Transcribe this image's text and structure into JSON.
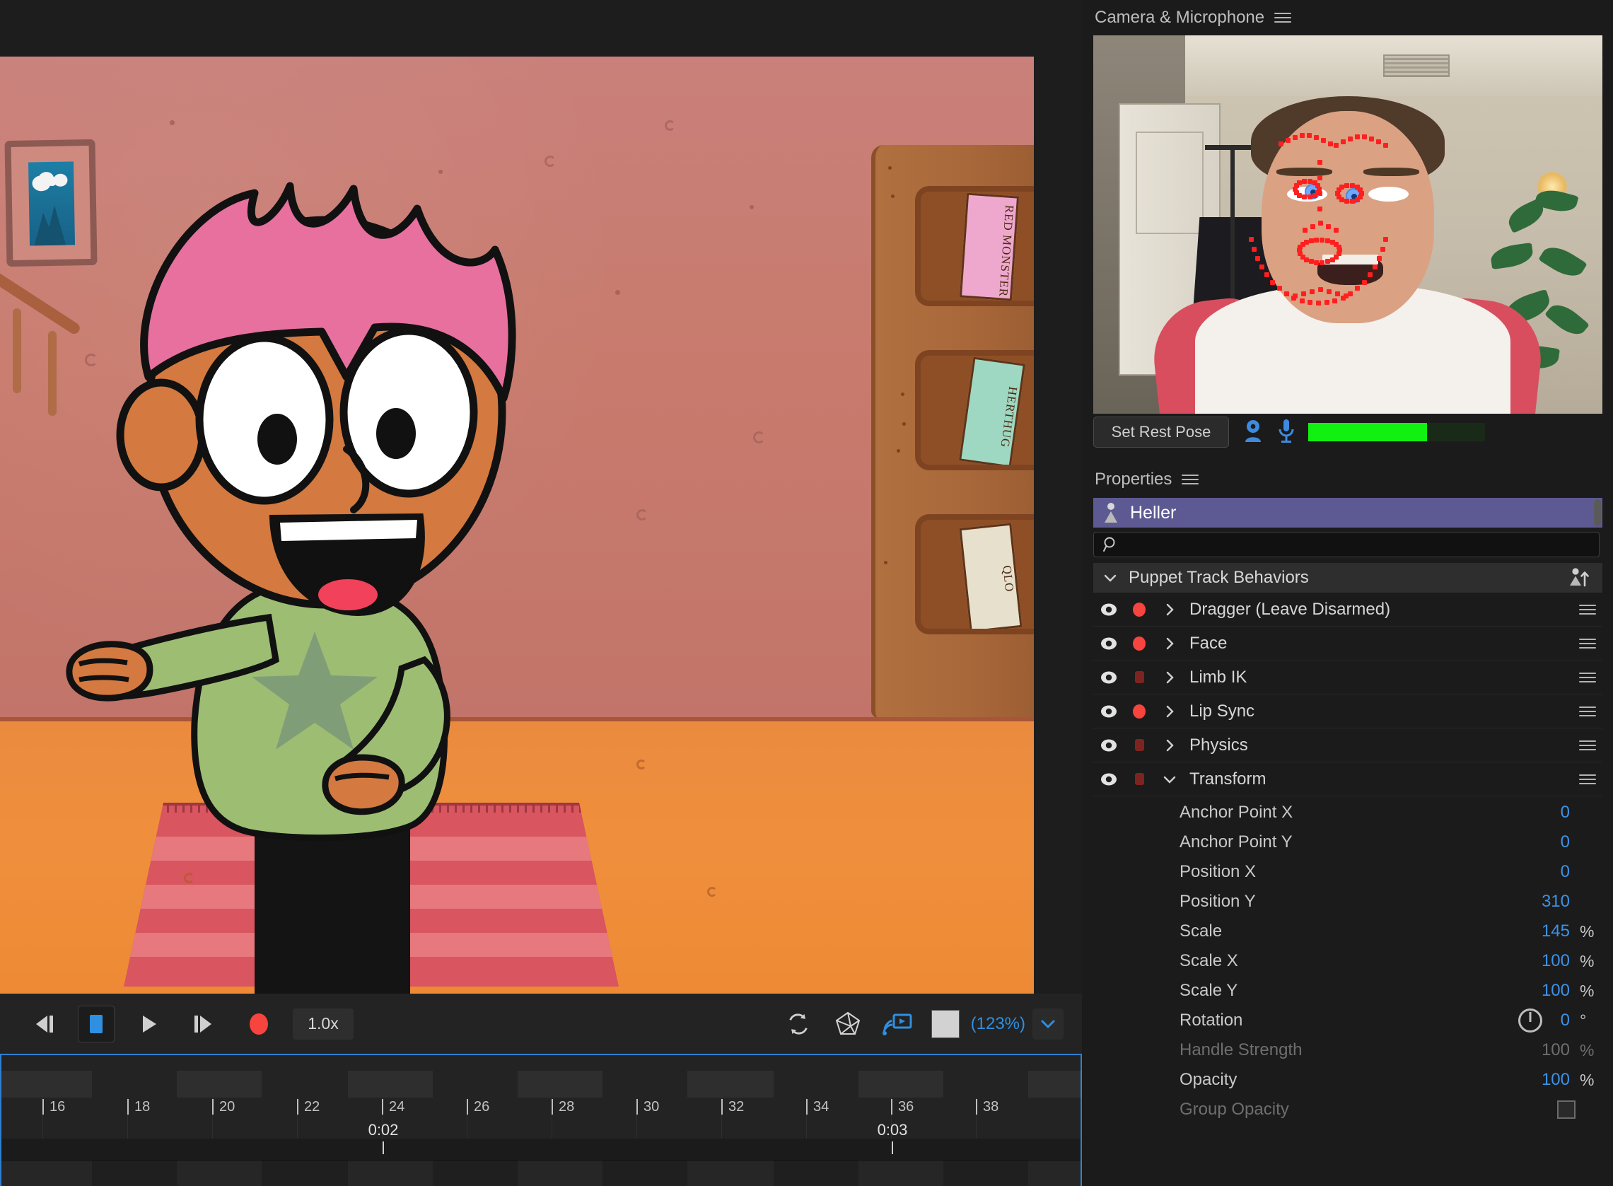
{
  "camera_panel": {
    "title": "Camera & Microphone",
    "menu_icon": "hamburger-menu-icon",
    "set_rest_pose_label": "Set Rest Pose",
    "camera_toggle_icon": "webcam-icon",
    "mic_toggle_icon": "microphone-icon",
    "audio_meter_level_percent": 67,
    "audio_meter_color": "#12f012"
  },
  "properties_panel": {
    "title": "Properties",
    "menu_icon": "hamburger-menu-icon",
    "puppet": {
      "name": "Heller",
      "icon": "puppet-icon",
      "highlight_color": "#5d5a93"
    },
    "search": {
      "value": "",
      "placeholder": "",
      "icon": "search-icon"
    },
    "group_header": {
      "label": "Puppet Track Behaviors",
      "expanded": true,
      "add_behavior_icon": "add-puppet-icon"
    },
    "behaviors": [
      {
        "name": "Dragger (Leave Disarmed)",
        "visible": true,
        "armed": true,
        "expanded": false
      },
      {
        "name": "Face",
        "visible": true,
        "armed": true,
        "expanded": false
      },
      {
        "name": "Limb IK",
        "visible": true,
        "armed": false,
        "expanded": false
      },
      {
        "name": "Lip Sync",
        "visible": true,
        "armed": true,
        "expanded": false
      },
      {
        "name": "Physics",
        "visible": true,
        "armed": false,
        "expanded": false
      },
      {
        "name": "Transform",
        "visible": true,
        "armed": false,
        "expanded": true
      }
    ],
    "transform_properties": [
      {
        "label": "Anchor Point X",
        "value": "0",
        "unit": "",
        "enabled": true,
        "control": "none"
      },
      {
        "label": "Anchor Point Y",
        "value": "0",
        "unit": "",
        "enabled": true,
        "control": "none"
      },
      {
        "label": "Position X",
        "value": "0",
        "unit": "",
        "enabled": true,
        "control": "none"
      },
      {
        "label": "Position Y",
        "value": "310",
        "unit": "",
        "enabled": true,
        "control": "none"
      },
      {
        "label": "Scale",
        "value": "145",
        "unit": "%",
        "enabled": true,
        "control": "none"
      },
      {
        "label": "Scale X",
        "value": "100",
        "unit": "%",
        "enabled": true,
        "control": "none"
      },
      {
        "label": "Scale Y",
        "value": "100",
        "unit": "%",
        "enabled": true,
        "control": "none"
      },
      {
        "label": "Rotation",
        "value": "0",
        "unit": "°",
        "enabled": true,
        "control": "dial"
      },
      {
        "label": "Handle Strength",
        "value": "100",
        "unit": "%",
        "enabled": false,
        "control": "none"
      },
      {
        "label": "Opacity",
        "value": "100",
        "unit": "%",
        "enabled": true,
        "control": "none"
      },
      {
        "label": "Group Opacity",
        "value": "",
        "unit": "",
        "enabled": false,
        "control": "checkbox"
      }
    ]
  },
  "playback_bar": {
    "step_back_icon": "step-backward-icon",
    "stop_icon": "stop-icon",
    "play_icon": "play-icon",
    "step_forward_icon": "step-forward-icon",
    "record_icon": "record-icon",
    "speed_label": "1.0x",
    "refresh_icon": "refresh-icon",
    "mesh_icon": "mesh-icon",
    "stream_icon": "stream-to-icon",
    "background_swatch_color": "#d2d2d2",
    "zoom_label": "(123%)",
    "zoom_caret_icon": "chevron-down-icon"
  },
  "timeline": {
    "selected": true,
    "selection_color": "#2f7fd1",
    "frame_ticks": [
      "16",
      "18",
      "20",
      "22",
      "24",
      "26",
      "28",
      "30",
      "32",
      "34",
      "36",
      "38"
    ],
    "second_markers": [
      {
        "label": "0:02",
        "at_frame": "24"
      },
      {
        "label": "0:03",
        "at_frame": "36"
      }
    ]
  },
  "scene": {
    "character": {
      "hair_color": "#e8709e",
      "skin_color": "#d4793f",
      "shirt_color": "#9dbd73",
      "star_color": "#7f9e78",
      "pants_color": "#141414",
      "tongue_color": "#f2415a"
    },
    "background": {
      "wall_color": "#c87b6d",
      "floor_color": "#ec8a3a",
      "rug_color": "#d9555f",
      "shelf_color": "#a9683a",
      "frame_border_color": "#8c5a52",
      "frame_art_color": "#1a6e93"
    },
    "shelf_books": [
      "RED MONSTER",
      "HERTHUG",
      "QLO"
    ]
  }
}
